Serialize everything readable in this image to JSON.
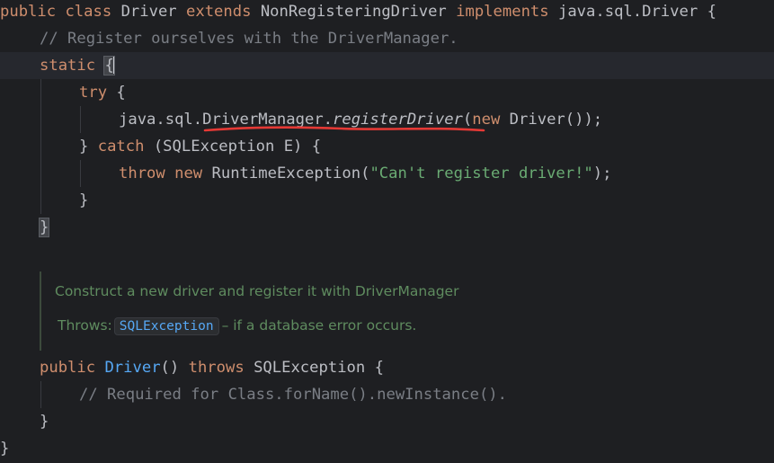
{
  "code": {
    "line1": {
      "kw_public": "public",
      "kw_class": "class",
      "class_name": "Driver",
      "kw_extends": "extends",
      "superclass": "NonRegisteringDriver",
      "kw_implements": "implements",
      "interface": "java.sql.Driver",
      "brace": "{"
    },
    "line2": {
      "comment": "// Register ourselves with the DriverManager."
    },
    "line3": {
      "kw_static": "static",
      "brace": "{"
    },
    "line4": {
      "kw_try": "try",
      "brace": "{"
    },
    "line5": {
      "pkg": "java.sql.",
      "class_ref": "DriverManager",
      "dot": ".",
      "method": "registerDriver",
      "paren_open": "(",
      "kw_new": "new",
      "ctor": "Driver());"
    },
    "line6": {
      "close_brace": "}",
      "kw_catch": "catch",
      "catch_params": "(SQLException E) {"
    },
    "line7": {
      "kw_throw": "throw",
      "kw_new": "new",
      "exception": "RuntimeException(",
      "message": "\"Can't register driver!\"",
      "tail": ");"
    },
    "line8": {
      "brace": "}"
    },
    "line9": {
      "brace": "}"
    },
    "line10": {
      "kw_public": "public",
      "ctor_name": "Driver",
      "parens": "()",
      "kw_throws": "throws",
      "exception": "SQLException",
      "brace": "{"
    },
    "line11": {
      "comment": "// Required for Class.forName().newInstance()."
    },
    "line12": {
      "brace": "}"
    },
    "line13": {
      "brace": "}"
    }
  },
  "javadoc": {
    "description": "Construct a new driver and register it with DriverManager",
    "throws_label": "Throws:",
    "throws_type": "SQLException",
    "throws_desc": "– if a database error occurs."
  },
  "colors": {
    "background": "#1e1f22",
    "keyword": "#cf8e6d",
    "comment": "#7a7e85",
    "string": "#6aab73",
    "function": "#56a8f5",
    "text": "#bcbec4",
    "underline": "#e53935"
  }
}
